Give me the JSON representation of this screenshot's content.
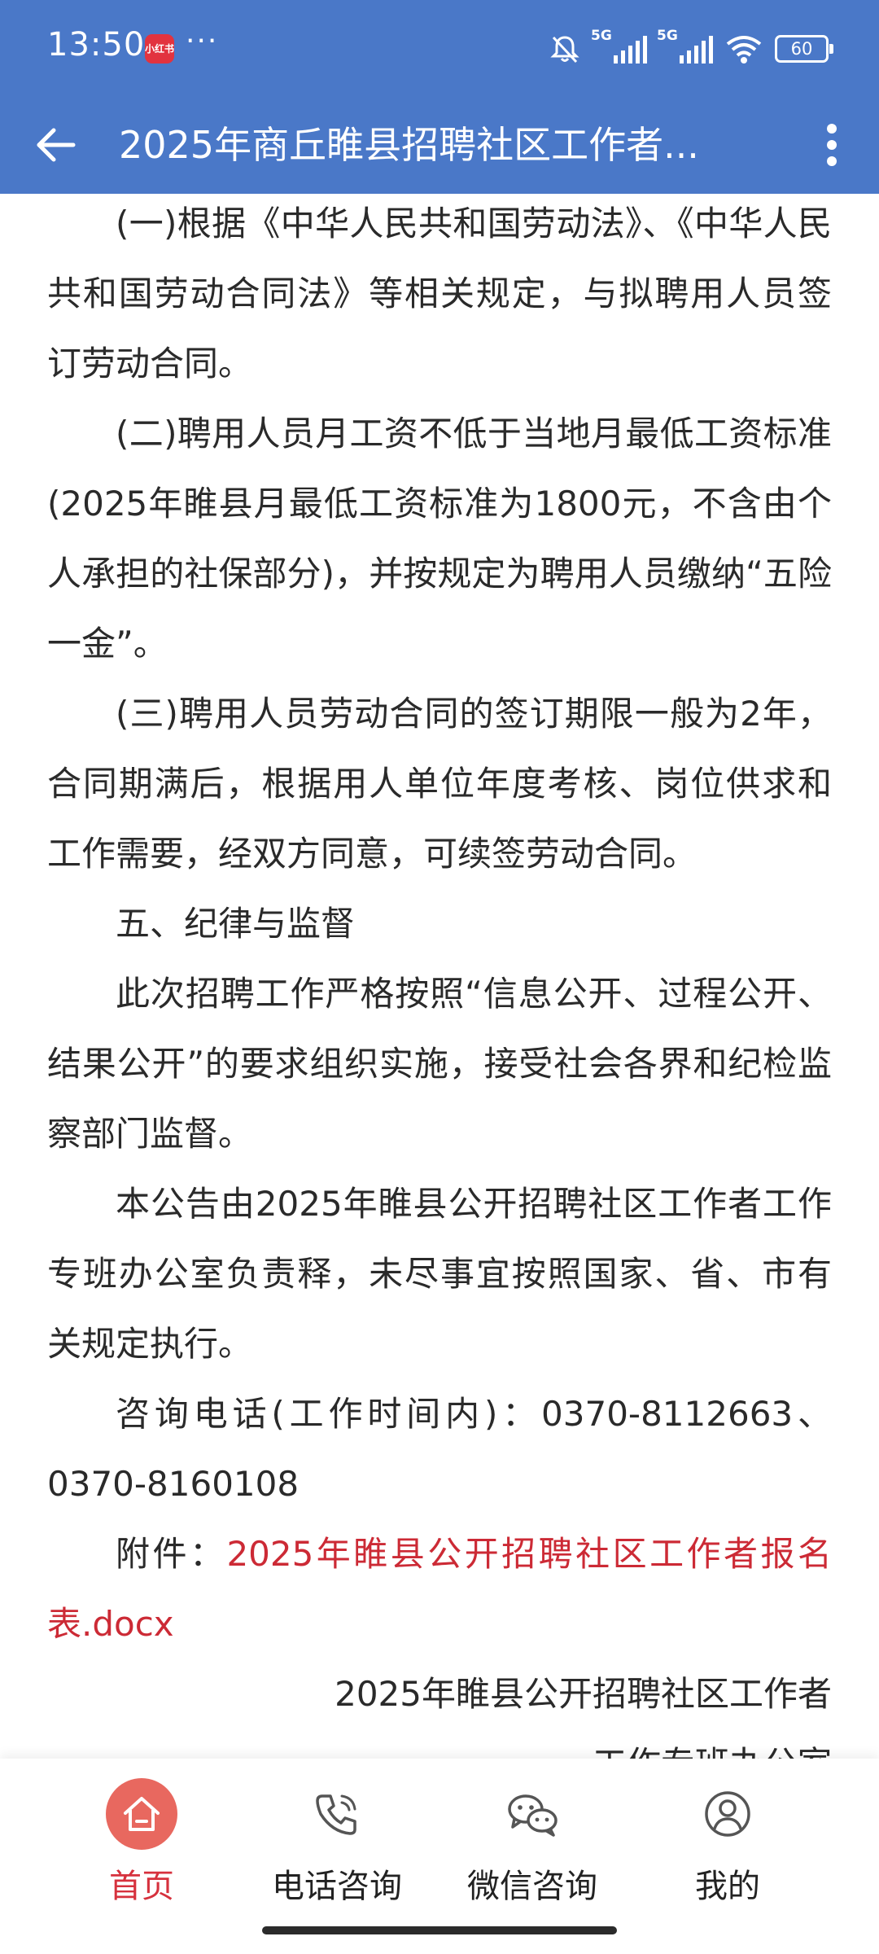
{
  "status_bar": {
    "time": "13:50",
    "app_badge": "小红书",
    "network_1": "5G",
    "network_2": "5G",
    "battery": "60"
  },
  "app_bar": {
    "title": "2025年商丘睢县招聘社区工作者..."
  },
  "article": {
    "paragraphs": [
      "(一)根据《中华人民共和国劳动法》、《中华人民共和国劳动合同法》等相关规定，与拟聘用人员签订劳动合同。",
      "(二)聘用人员月工资不低于当地月最低工资标准(2025年睢县月最低工资标准为1800元，不含由个人承担的社保部分)，并按规定为聘用人员缴纳“五险一金”。",
      "(三)聘用人员劳动合同的签订期限一般为2年，合同期满后，根据用人单位年度考核、岗位供求和工作需要，经双方同意，可续签劳动合同。",
      "五、纪律与监督",
      "此次招聘工作严格按照“信息公开、过程公开、结果公开”的要求组织实施，接受社会各界和纪检监察部门监督。",
      "本公告由2025年睢县公开招聘社区工作者工作专班办公室负责释，未尽事宜按照国家、省、市有关规定执行。",
      "咨询电话(工作时间内)：0370-8112663、0370-8160108"
    ],
    "attachment_label": "附件：",
    "attachment_link": "2025年睢县公开招聘社区工作者报名表.docx",
    "signature_line1": "2025年睢县公开招聘社区工作者",
    "signature_line2": "工作专班办公室"
  },
  "bottom_nav": {
    "items": [
      {
        "label": "首页",
        "icon": "home-icon",
        "active": true
      },
      {
        "label": "电话咨询",
        "icon": "phone-icon",
        "active": false
      },
      {
        "label": "微信咨询",
        "icon": "wechat-icon",
        "active": false
      },
      {
        "label": "我的",
        "icon": "user-icon",
        "active": false
      }
    ]
  },
  "colors": {
    "primary": "#4a78c8",
    "accent": "#d6313d",
    "link": "#cc2a35",
    "home_bg": "#e8685f"
  }
}
